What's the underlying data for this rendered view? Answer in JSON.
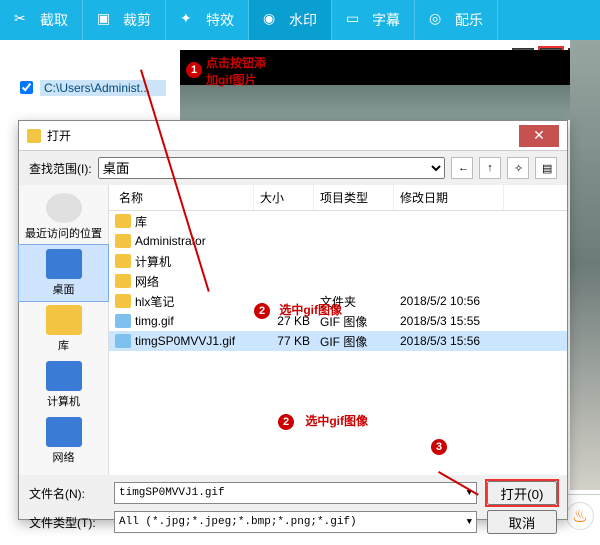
{
  "toolbar": {
    "items": [
      {
        "icon": "scissors",
        "label": "截取"
      },
      {
        "icon": "crop",
        "label": "裁剪"
      },
      {
        "icon": "effects",
        "label": "特效"
      },
      {
        "icon": "watermark",
        "label": "水印"
      },
      {
        "icon": "subtitle",
        "label": "字幕"
      },
      {
        "icon": "music",
        "label": "配乐"
      }
    ],
    "active_index": 3
  },
  "subbar": {
    "btn1": "◧",
    "btn2": "✎",
    "btn_close": "✕"
  },
  "left_file": {
    "path": "C:\\Users\\Administ..."
  },
  "annotations": {
    "n1": "1",
    "t1a": "点击按钮添",
    "t1b": "加gif图片",
    "n2": "2",
    "t2": "选中gif图像",
    "n3": "3"
  },
  "dialog": {
    "title": "打开",
    "lookin_label": "查找范围(I):",
    "lookin_value": "桌面",
    "places": [
      {
        "label": "最近访问的位置",
        "icon": "recent"
      },
      {
        "label": "桌面",
        "icon": "desktop"
      },
      {
        "label": "库",
        "icon": "lib"
      },
      {
        "label": "计算机",
        "icon": "computer"
      },
      {
        "label": "网络",
        "icon": "net"
      }
    ],
    "places_active": 1,
    "columns": {
      "name": "名称",
      "size": "大小",
      "type": "项目类型",
      "date": "修改日期"
    },
    "rows": [
      {
        "name": "库",
        "size": "",
        "type": "",
        "date": "",
        "ico": "lib"
      },
      {
        "name": "Administrator",
        "size": "",
        "type": "",
        "date": "",
        "ico": "folder"
      },
      {
        "name": "计算机",
        "size": "",
        "type": "",
        "date": "",
        "ico": "computer"
      },
      {
        "name": "网络",
        "size": "",
        "type": "",
        "date": "",
        "ico": "net"
      },
      {
        "name": "hlx笔记",
        "size": "",
        "type": "文件夹",
        "date": "2018/5/2 10:56",
        "ico": "folder"
      },
      {
        "name": "timg.gif",
        "size": "27 KB",
        "type": "GIF 图像",
        "date": "2018/5/3 15:55",
        "ico": "gif"
      },
      {
        "name": "timgSP0MVVJ1.gif",
        "size": "77 KB",
        "type": "GIF 图像",
        "date": "2018/5/3 15:56",
        "ico": "gif"
      }
    ],
    "selected_row": 6,
    "filename_label": "文件名(N):",
    "filename_value": "timgSP0MVVJ1.gif",
    "filetype_label": "文件类型(T):",
    "filetype_value": "All (*.jpg;*.jpeg;*.bmp;*.png;*.gif)",
    "open_btn": "打开(0)",
    "cancel_btn": "取消"
  }
}
